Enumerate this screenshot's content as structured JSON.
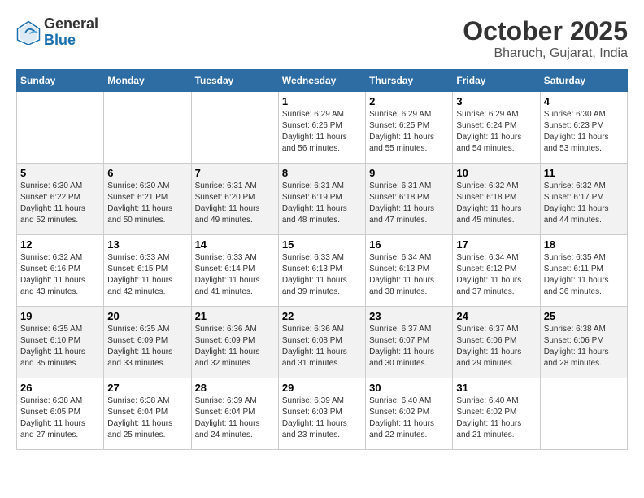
{
  "header": {
    "logo_general": "General",
    "logo_blue": "Blue",
    "title": "October 2025",
    "subtitle": "Bharuch, Gujarat, India"
  },
  "calendar": {
    "weekdays": [
      "Sunday",
      "Monday",
      "Tuesday",
      "Wednesday",
      "Thursday",
      "Friday",
      "Saturday"
    ],
    "weeks": [
      [
        {
          "day": "",
          "info": ""
        },
        {
          "day": "",
          "info": ""
        },
        {
          "day": "",
          "info": ""
        },
        {
          "day": "1",
          "info": "Sunrise: 6:29 AM\nSunset: 6:26 PM\nDaylight: 11 hours\nand 56 minutes."
        },
        {
          "day": "2",
          "info": "Sunrise: 6:29 AM\nSunset: 6:25 PM\nDaylight: 11 hours\nand 55 minutes."
        },
        {
          "day": "3",
          "info": "Sunrise: 6:29 AM\nSunset: 6:24 PM\nDaylight: 11 hours\nand 54 minutes."
        },
        {
          "day": "4",
          "info": "Sunrise: 6:30 AM\nSunset: 6:23 PM\nDaylight: 11 hours\nand 53 minutes."
        }
      ],
      [
        {
          "day": "5",
          "info": "Sunrise: 6:30 AM\nSunset: 6:22 PM\nDaylight: 11 hours\nand 52 minutes."
        },
        {
          "day": "6",
          "info": "Sunrise: 6:30 AM\nSunset: 6:21 PM\nDaylight: 11 hours\nand 50 minutes."
        },
        {
          "day": "7",
          "info": "Sunrise: 6:31 AM\nSunset: 6:20 PM\nDaylight: 11 hours\nand 49 minutes."
        },
        {
          "day": "8",
          "info": "Sunrise: 6:31 AM\nSunset: 6:19 PM\nDaylight: 11 hours\nand 48 minutes."
        },
        {
          "day": "9",
          "info": "Sunrise: 6:31 AM\nSunset: 6:18 PM\nDaylight: 11 hours\nand 47 minutes."
        },
        {
          "day": "10",
          "info": "Sunrise: 6:32 AM\nSunset: 6:18 PM\nDaylight: 11 hours\nand 45 minutes."
        },
        {
          "day": "11",
          "info": "Sunrise: 6:32 AM\nSunset: 6:17 PM\nDaylight: 11 hours\nand 44 minutes."
        }
      ],
      [
        {
          "day": "12",
          "info": "Sunrise: 6:32 AM\nSunset: 6:16 PM\nDaylight: 11 hours\nand 43 minutes."
        },
        {
          "day": "13",
          "info": "Sunrise: 6:33 AM\nSunset: 6:15 PM\nDaylight: 11 hours\nand 42 minutes."
        },
        {
          "day": "14",
          "info": "Sunrise: 6:33 AM\nSunset: 6:14 PM\nDaylight: 11 hours\nand 41 minutes."
        },
        {
          "day": "15",
          "info": "Sunrise: 6:33 AM\nSunset: 6:13 PM\nDaylight: 11 hours\nand 39 minutes."
        },
        {
          "day": "16",
          "info": "Sunrise: 6:34 AM\nSunset: 6:13 PM\nDaylight: 11 hours\nand 38 minutes."
        },
        {
          "day": "17",
          "info": "Sunrise: 6:34 AM\nSunset: 6:12 PM\nDaylight: 11 hours\nand 37 minutes."
        },
        {
          "day": "18",
          "info": "Sunrise: 6:35 AM\nSunset: 6:11 PM\nDaylight: 11 hours\nand 36 minutes."
        }
      ],
      [
        {
          "day": "19",
          "info": "Sunrise: 6:35 AM\nSunset: 6:10 PM\nDaylight: 11 hours\nand 35 minutes."
        },
        {
          "day": "20",
          "info": "Sunrise: 6:35 AM\nSunset: 6:09 PM\nDaylight: 11 hours\nand 33 minutes."
        },
        {
          "day": "21",
          "info": "Sunrise: 6:36 AM\nSunset: 6:09 PM\nDaylight: 11 hours\nand 32 minutes."
        },
        {
          "day": "22",
          "info": "Sunrise: 6:36 AM\nSunset: 6:08 PM\nDaylight: 11 hours\nand 31 minutes."
        },
        {
          "day": "23",
          "info": "Sunrise: 6:37 AM\nSunset: 6:07 PM\nDaylight: 11 hours\nand 30 minutes."
        },
        {
          "day": "24",
          "info": "Sunrise: 6:37 AM\nSunset: 6:06 PM\nDaylight: 11 hours\nand 29 minutes."
        },
        {
          "day": "25",
          "info": "Sunrise: 6:38 AM\nSunset: 6:06 PM\nDaylight: 11 hours\nand 28 minutes."
        }
      ],
      [
        {
          "day": "26",
          "info": "Sunrise: 6:38 AM\nSunset: 6:05 PM\nDaylight: 11 hours\nand 27 minutes."
        },
        {
          "day": "27",
          "info": "Sunrise: 6:38 AM\nSunset: 6:04 PM\nDaylight: 11 hours\nand 25 minutes."
        },
        {
          "day": "28",
          "info": "Sunrise: 6:39 AM\nSunset: 6:04 PM\nDaylight: 11 hours\nand 24 minutes."
        },
        {
          "day": "29",
          "info": "Sunrise: 6:39 AM\nSunset: 6:03 PM\nDaylight: 11 hours\nand 23 minutes."
        },
        {
          "day": "30",
          "info": "Sunrise: 6:40 AM\nSunset: 6:02 PM\nDaylight: 11 hours\nand 22 minutes."
        },
        {
          "day": "31",
          "info": "Sunrise: 6:40 AM\nSunset: 6:02 PM\nDaylight: 11 hours\nand 21 minutes."
        },
        {
          "day": "",
          "info": ""
        }
      ]
    ]
  }
}
